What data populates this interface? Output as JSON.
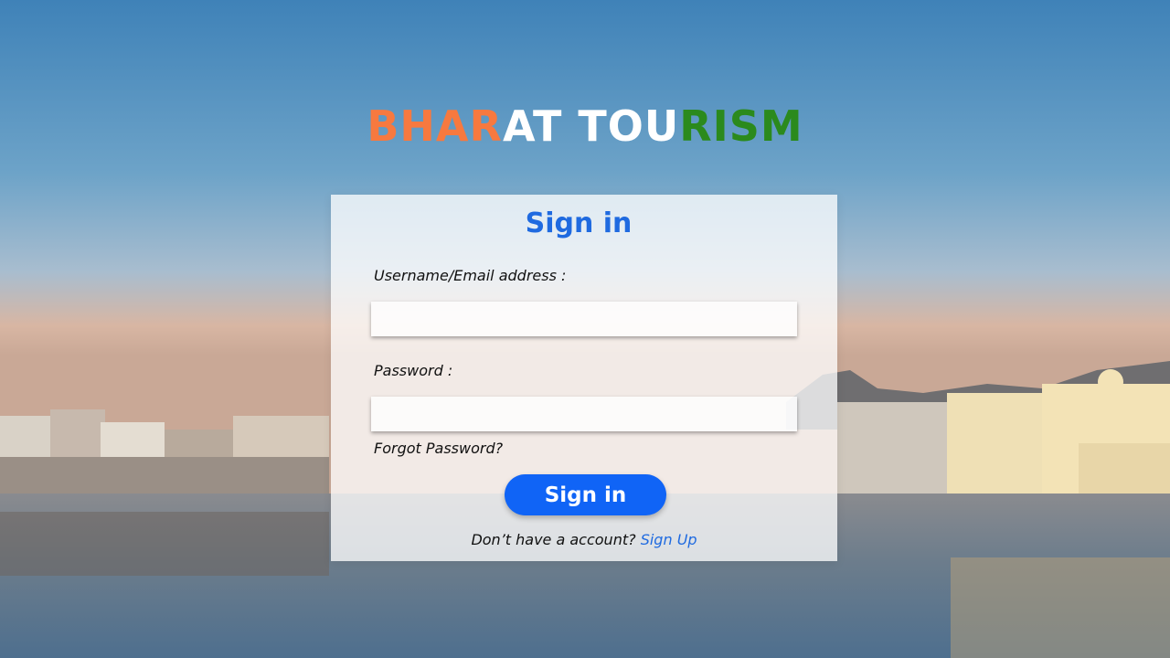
{
  "brand": {
    "part1": "BHAR",
    "part2": "AT TOU",
    "part3": "RISM",
    "colors": {
      "saffron": "#f7793f",
      "white": "#ffffff",
      "green": "#2b8a1d"
    }
  },
  "form": {
    "title": "Sign in",
    "username_label": "Username/Email address :",
    "username_value": "",
    "password_label": "Password :",
    "password_value": "",
    "forgot_label": "Forgot Password?",
    "submit_label": "Sign in",
    "signup_prompt": "Don’t have a account?",
    "signup_link": "Sign Up"
  },
  "colors": {
    "accent": "#1064f6",
    "title": "#1f6ae0"
  }
}
